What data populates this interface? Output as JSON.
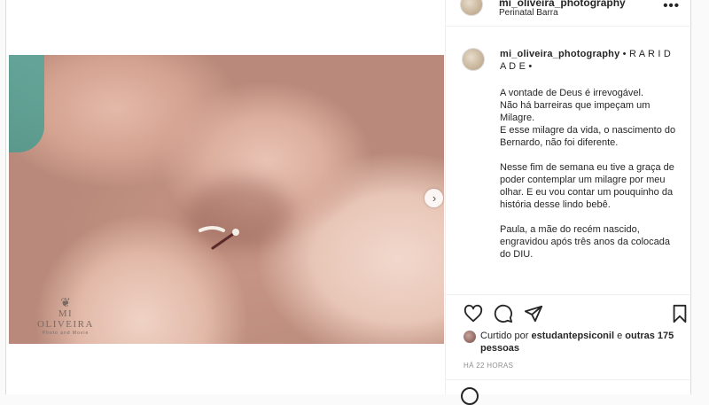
{
  "header": {
    "username": "mi_oliveira_photography",
    "location": "Perinatal Barra",
    "more_label": "•••"
  },
  "photo": {
    "watermark_name": "MI OLIVEIRA",
    "watermark_sub": "Photo and Movie",
    "next_label": "›"
  },
  "caption": {
    "username": "mi_oliveira_photography",
    "title": " • R A R I D A D E •",
    "body": "A vontade de Deus é irrevogável.\nNão há barreiras que impeçam um Milagre.\nE esse milagre da vida, o nascimento do Bernardo, não foi diferente.\n\nNesse fim de semana eu tive a graça de poder contemplar um milagre por meu olhar. E eu vou contar um pouquinho da história desse lindo bebê.\n\nPaula, a mãe do recém nascido, engravidou após três anos da colocada do DIU."
  },
  "likes": {
    "prefix": "Curtido por ",
    "user": "estudantepsiconil",
    "mid": " e ",
    "others": "outras 175 pessoas"
  },
  "time": "HÁ 22 HORAS",
  "icons": [
    "heart-icon",
    "comment-icon",
    "share-icon",
    "bookmark-icon",
    "more-options-icon",
    "next-arrow-icon",
    "emoji-icon"
  ]
}
